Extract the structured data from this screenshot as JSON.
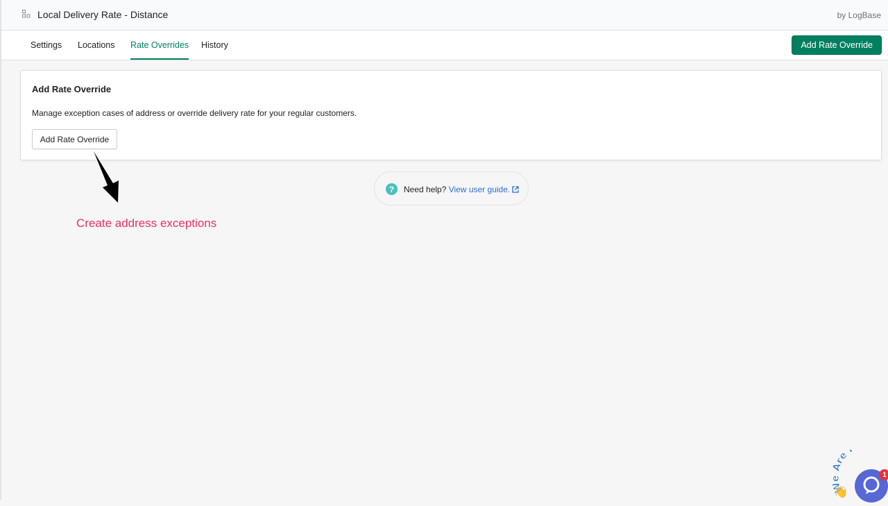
{
  "header": {
    "app_title": "Local Delivery Rate - Distance",
    "byline": "by LogBase"
  },
  "nav": {
    "tabs": [
      {
        "label": "Settings",
        "active": false
      },
      {
        "label": "Locations",
        "active": false
      },
      {
        "label": "Rate Overrides",
        "active": true
      },
      {
        "label": "History",
        "active": false
      }
    ],
    "primary_button": "Add Rate Override"
  },
  "card": {
    "title": "Add Rate Override",
    "description": "Manage exception cases of address or override delivery rate for your regular customers.",
    "button": "Add Rate Override"
  },
  "help": {
    "prefix": "Need help?",
    "link": "View user guide."
  },
  "annotation": {
    "text": "Create address exceptions",
    "color": "#e8326a"
  },
  "chat_widget": {
    "badge_text": "We Are Here",
    "unread_count": "1"
  },
  "colors": {
    "accent": "#008060",
    "link": "#2c6ecb",
    "chat": "#5867d6"
  }
}
